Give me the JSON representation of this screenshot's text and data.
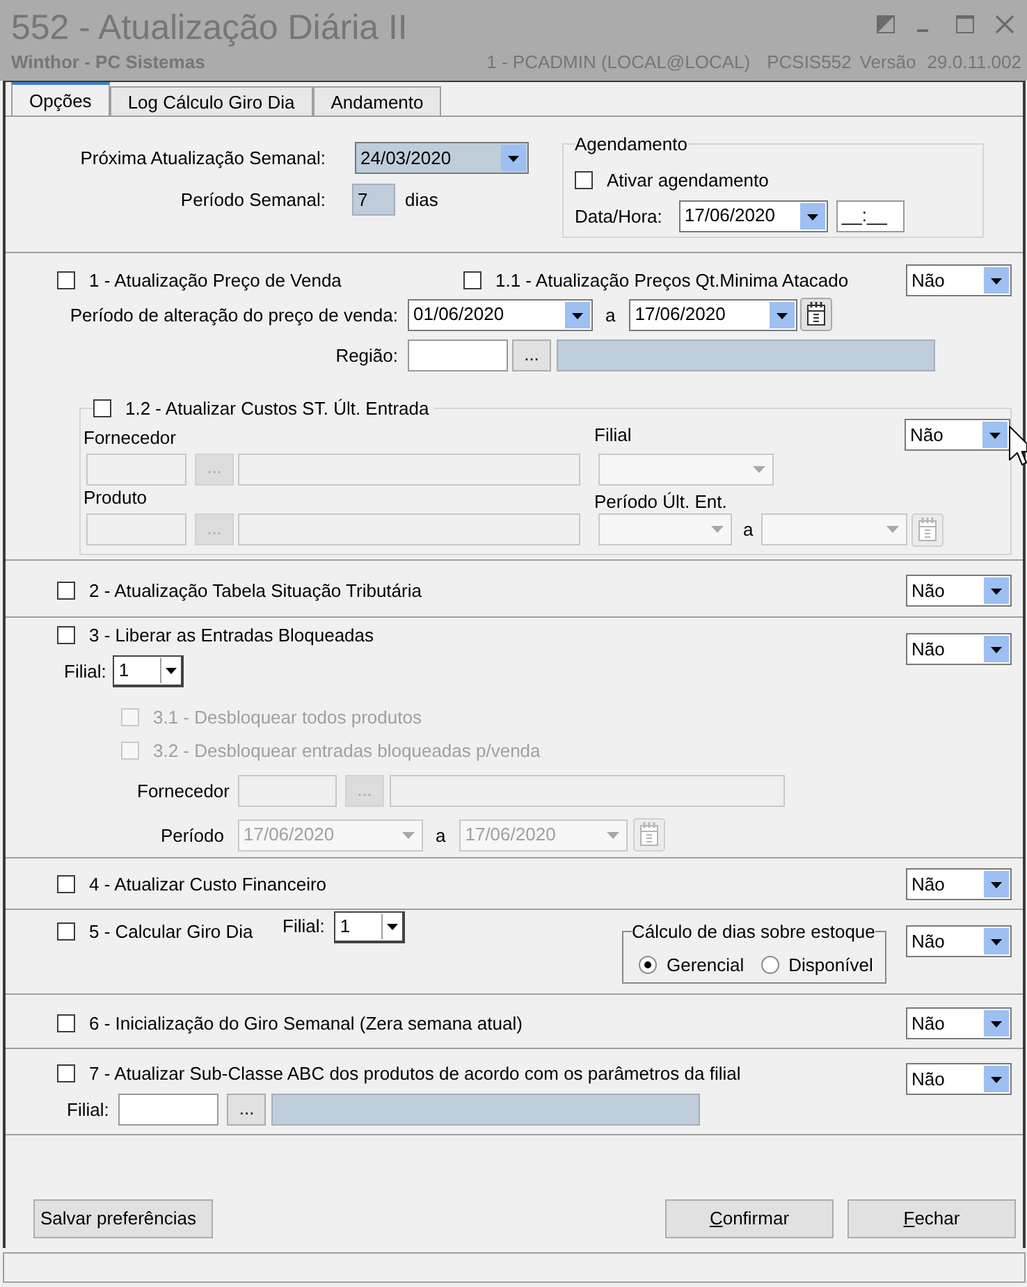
{
  "window": {
    "title": "552 - Atualização Diária II",
    "subtitle": "Winthor - PC Sistemas",
    "user": "1 - PCADMIN (LOCAL@LOCAL)",
    "program": "PCSIS552",
    "version_label": "Versão",
    "version": "29.0.11.002"
  },
  "tabs": [
    {
      "label": "Opções",
      "selected": true
    },
    {
      "label": "Log Cálculo Giro Dia",
      "selected": false
    },
    {
      "label": "Andamento",
      "selected": false
    }
  ],
  "weekly_update": {
    "next_label": "Próxima Atualização Semanal:",
    "next_date": "24/03/2020",
    "period_label": "Período Semanal:",
    "period": "7",
    "period_unit": "dias"
  },
  "schedule": {
    "title": "Agendamento",
    "enable": {
      "label": "Ativar agendamento",
      "checked": false
    },
    "datetime_label": "Data/Hora:",
    "date": "17/06/2020",
    "time": "__:__"
  },
  "price_update": {
    "option": {
      "label": "1 - Atualização Preço de Venda",
      "checked": false
    },
    "wholesale_option": {
      "label": "1.1 - Atualização Preços Qt.Minima Atacado",
      "checked": false
    },
    "mode": "Não",
    "period_label": "Período de alteração do preço de venda:",
    "date_from": "01/06/2020",
    "range_separator": "a",
    "date_to": "17/06/2020",
    "region_label": "Região:",
    "region_lookup": "...",
    "st_costs": {
      "option": {
        "label": "1.2 - Atualizar Custos ST. Últ. Entrada",
        "checked": false
      },
      "mode": "Não",
      "disabled": true,
      "supplier_label": "Fornecedor",
      "supplier_lookup": "...",
      "branch_label": "Filial",
      "product_label": "Produto",
      "product_lookup": "...",
      "period_label": "Período Últ. Ent.",
      "range_separator": "a"
    }
  },
  "tax_table": {
    "option": {
      "label": "2 - Atualização Tabela Situação Tributária",
      "checked": false
    },
    "mode": "Não"
  },
  "blocked_entries": {
    "option": {
      "label": "3 - Liberar as Entradas Bloqueadas",
      "checked": false
    },
    "mode": "Não",
    "branch_label": "Filial:",
    "branch": "1",
    "sub_options": [
      {
        "label": "3.1 - Desbloquear todos produtos",
        "checked": false,
        "disabled": true
      },
      {
        "label": "3.2 - Desbloquear entradas bloqueadas p/venda",
        "checked": false,
        "disabled": true
      }
    ],
    "filters_disabled": true,
    "supplier_label": "Fornecedor",
    "supplier_lookup": "...",
    "period_label": "Período",
    "date_from": "17/06/2020",
    "range_separator": "a",
    "date_to": "17/06/2020"
  },
  "financial_cost": {
    "option": {
      "label": "4 - Atualizar Custo Financeiro",
      "checked": false
    },
    "mode": "Não"
  },
  "daily_turnover": {
    "option": {
      "label": "5 - Calcular Giro Dia",
      "checked": false
    },
    "branch_label": "Filial:",
    "branch": "1",
    "stock_days": {
      "title": "Cálculo de dias sobre estoque",
      "choices": [
        {
          "label": "Gerencial",
          "selected": true
        },
        {
          "label": "Disponível",
          "selected": false
        }
      ]
    },
    "mode": "Não"
  },
  "weekly_reset": {
    "option": {
      "label": "6 - Inicialização do Giro Semanal (Zera semana atual)",
      "checked": false
    },
    "mode": "Não"
  },
  "abc_subclass": {
    "option": {
      "label": "7 - Atualizar Sub-Classe ABC dos produtos de acordo com os parâmetros da filial",
      "checked": false
    },
    "mode": "Não",
    "branch_label": "Filial:",
    "branch_lookup": "..."
  },
  "buttons": [
    {
      "label": "Salvar preferências",
      "mnemonic": false
    },
    {
      "label": "Confirmar",
      "mnemonic": true
    },
    {
      "label": "Fechar",
      "mnemonic": true
    }
  ]
}
